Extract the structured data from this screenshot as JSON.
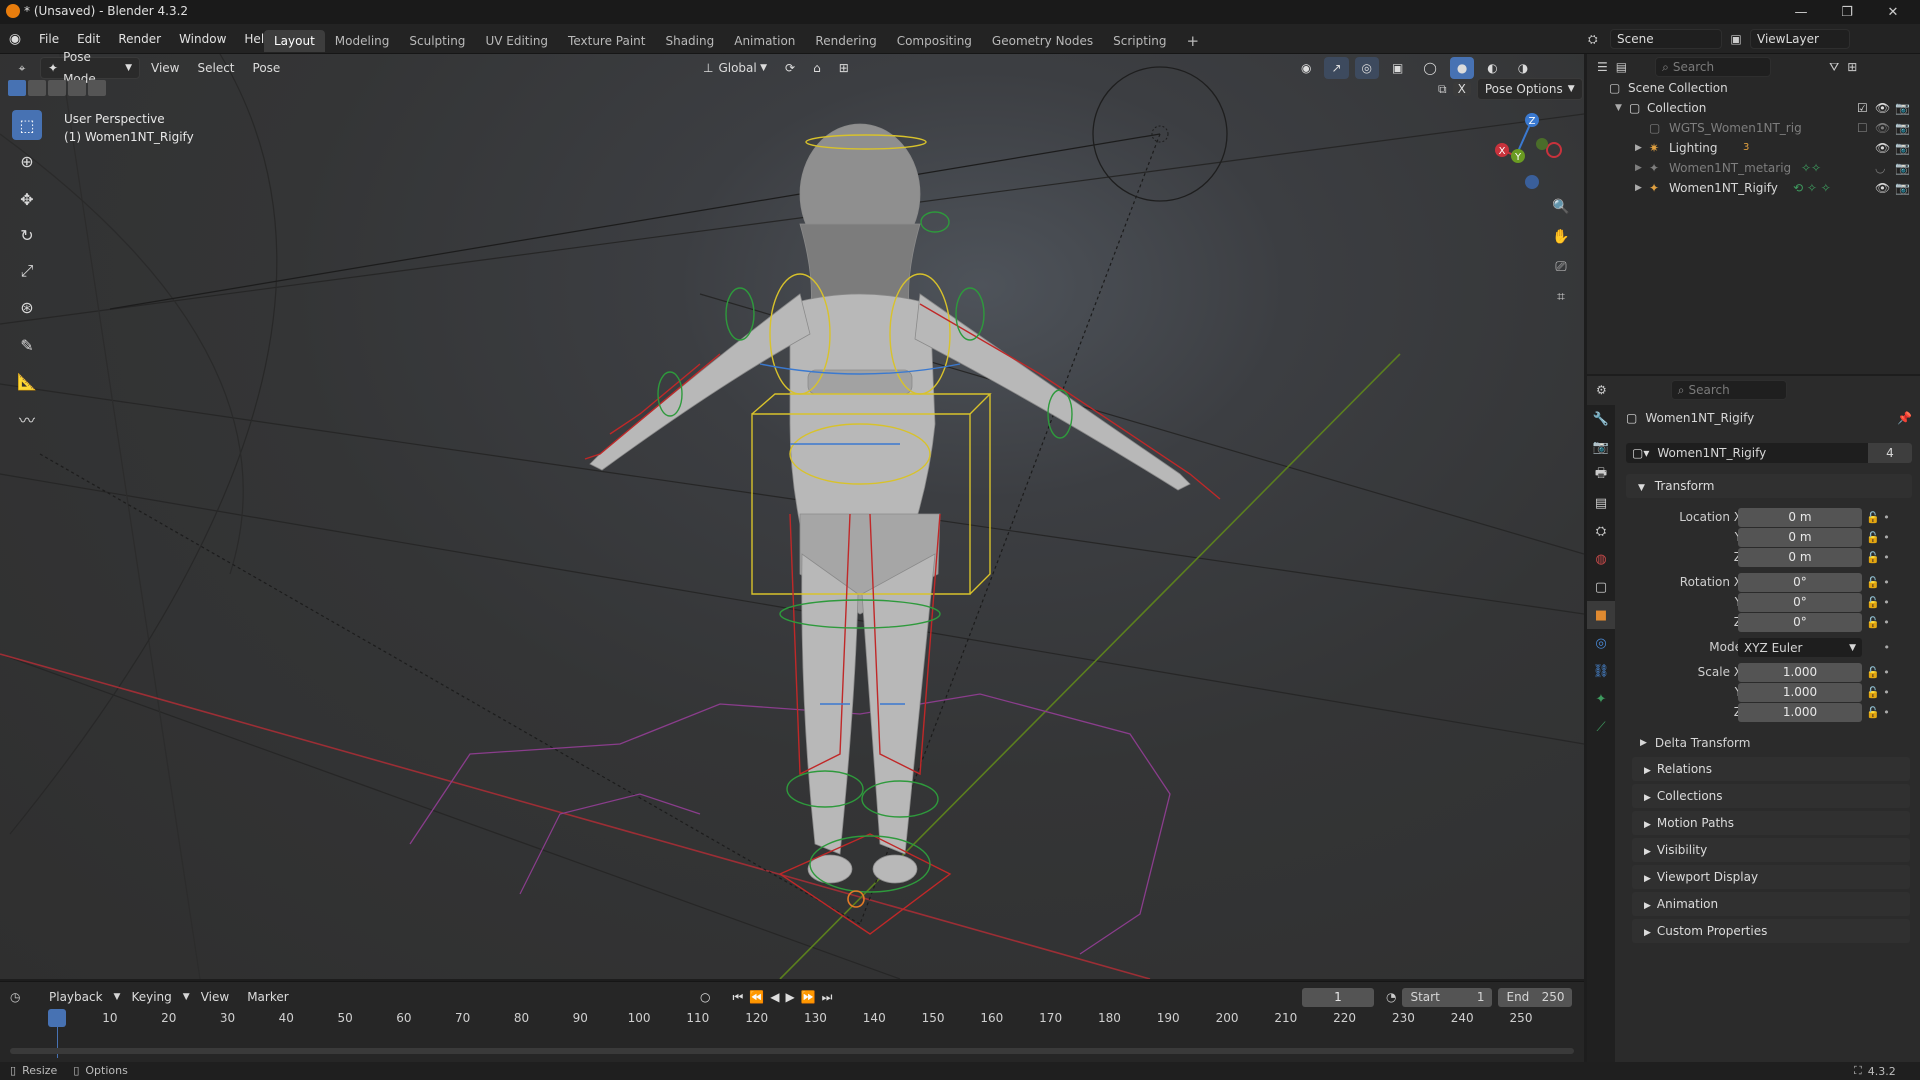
{
  "window": {
    "title": "* (Unsaved) - Blender 4.3.2",
    "controls": [
      "—",
      "❐",
      "✕"
    ]
  },
  "menu": [
    "File",
    "Edit",
    "Render",
    "Window",
    "Help"
  ],
  "workspaces": [
    {
      "label": "Layout",
      "active": true
    },
    {
      "label": "Modeling"
    },
    {
      "label": "Sculpting"
    },
    {
      "label": "UV Editing"
    },
    {
      "label": "Texture Paint"
    },
    {
      "label": "Shading"
    },
    {
      "label": "Animation"
    },
    {
      "label": "Rendering"
    },
    {
      "label": "Compositing"
    },
    {
      "label": "Geometry Nodes"
    },
    {
      "label": "Scripting"
    }
  ],
  "scene": {
    "label": "Scene",
    "view_layer": "ViewLayer"
  },
  "viewport": {
    "mode": "Pose Mode",
    "menus": [
      "View",
      "Select",
      "Pose"
    ],
    "orientation": "Global",
    "pose_options": "Pose Options",
    "perspective_label": "User Perspective",
    "object_label": "(1) Women1NT_Rigify",
    "gizmo_axes": {
      "x": "X",
      "y": "Y",
      "z": "Z"
    },
    "x_label": "X"
  },
  "outliner": {
    "search_placeholder": "Search",
    "scene_collection": "Scene Collection",
    "items": [
      {
        "label": "Collection",
        "level": 1
      },
      {
        "label": "WGTS_Women1NT_rig",
        "level": 2,
        "dim": true
      },
      {
        "label": "Lighting",
        "level": 2,
        "badge": "3"
      },
      {
        "label": "Women1NT_metarig",
        "level": 2,
        "dim": true
      },
      {
        "label": "Women1NT_Rigify",
        "level": 2
      }
    ]
  },
  "properties": {
    "search_placeholder": "Search",
    "object_name": "Women1NT_Rigify",
    "data_name": "Women1NT_Rigify",
    "users": "4",
    "transform_label": "Transform",
    "location": {
      "label": "Location X",
      "x": "0 m",
      "y_label": "Y",
      "y": "0 m",
      "z_label": "Z",
      "z": "0 m"
    },
    "rotation": {
      "label": "Rotation X",
      "x": "0°",
      "y_label": "Y",
      "y": "0°",
      "z_label": "Z",
      "z": "0°"
    },
    "mode": {
      "label": "Mode",
      "value": "XYZ Euler"
    },
    "scale": {
      "label": "Scale X",
      "x": "1.000",
      "y_label": "Y",
      "y": "1.000",
      "z_label": "Z",
      "z": "1.000"
    },
    "delta_transform": "Delta Transform",
    "panels": [
      "Relations",
      "Collections",
      "Motion Paths",
      "Visibility",
      "Viewport Display",
      "Animation",
      "Custom Properties"
    ]
  },
  "timeline": {
    "menus": [
      "Playback",
      "Keying",
      "View",
      "Marker"
    ],
    "current_frame": "1",
    "start_label": "Start",
    "start": "1",
    "end_label": "End",
    "end": "250",
    "ticks": [
      "1",
      "10",
      "20",
      "30",
      "40",
      "50",
      "60",
      "70",
      "80",
      "90",
      "100",
      "110",
      "120",
      "130",
      "140",
      "150",
      "160",
      "170",
      "180",
      "190",
      "200",
      "210",
      "220",
      "230",
      "240",
      "250"
    ]
  },
  "statusbar": {
    "left1": "Resize",
    "left2": "Options",
    "version": "4.3.2"
  },
  "colors": {
    "accent": "#4772b3",
    "x_axis": "#c8323c",
    "y_axis": "#6a9b22",
    "z_axis": "#3a79d0",
    "pose_bone_yellow": "#d8c22b",
    "bone_red": "#c02828"
  }
}
